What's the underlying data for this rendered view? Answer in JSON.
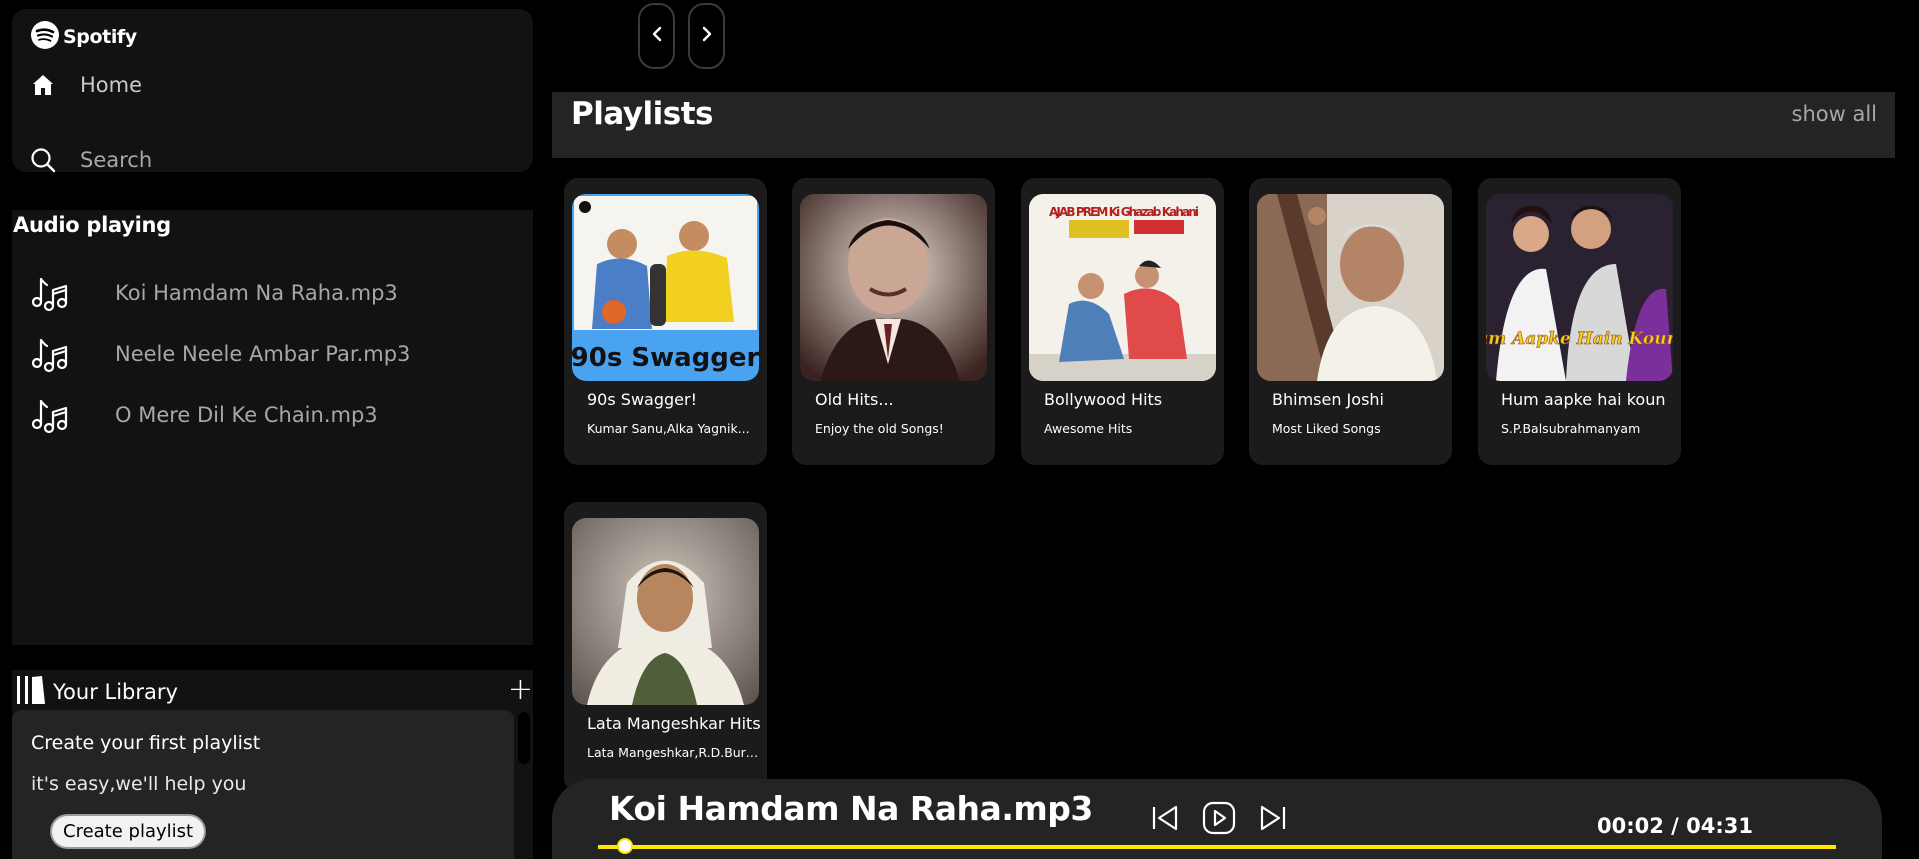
{
  "app": {
    "name": "Spotify"
  },
  "nav": {
    "home_label": "Home",
    "search_label": "Search"
  },
  "audio": {
    "title": "Audio playing",
    "items": [
      {
        "label": "Koi Hamdam Na Raha.mp3"
      },
      {
        "label": "Neele Neele Ambar Par.mp3"
      },
      {
        "label": "O Mere Dil Ke Chain.mp3"
      }
    ]
  },
  "library": {
    "title": "Your Library",
    "create_title": "Create your first playlist",
    "create_subtitle": "it's easy,we'll help you",
    "create_button": "Create playlist"
  },
  "playlists": {
    "title": "Playlists",
    "show_all": "show all",
    "cards": [
      {
        "title": "90s Swagger!",
        "subtitle": "Kumar Sanu,Alka Yagnik...",
        "cover_text": "90s Swagger"
      },
      {
        "title": "Old Hits...",
        "subtitle": "Enjoy the old Songs!"
      },
      {
        "title": "Bollywood Hits",
        "subtitle": "Awesome Hits",
        "cover_text": "AJAB PREM Ki Ghazab Kahani"
      },
      {
        "title": "Bhimsen Joshi",
        "subtitle": "Most Liked Songs"
      },
      {
        "title": "Hum aapke hai koun",
        "subtitle": "S.P.Balsubrahmanyam",
        "cover_text": "Hum Aapke Hain Koun..!"
      },
      {
        "title": "Lata Mangeshkar Hits",
        "subtitle": "Lata Mangeshkar,R.D.Burman"
      }
    ]
  },
  "player": {
    "song": "Koi Hamdam Na Raha.mp3",
    "time": "00:02 / 04:31",
    "progress": 0.0074
  },
  "colors": {
    "accent": "#ffe600",
    "panel": "#121212",
    "card": "#1b1b1b",
    "muted_text": "#a7a7a7"
  }
}
